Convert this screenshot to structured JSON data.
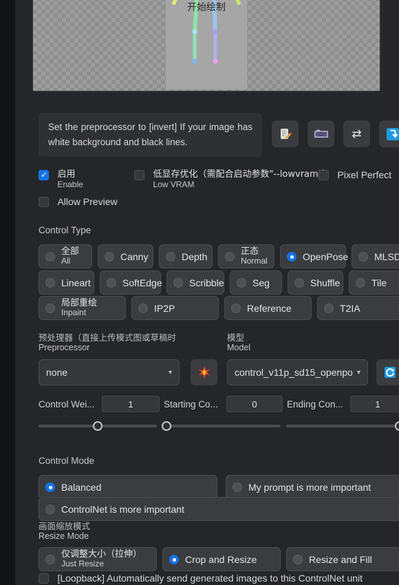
{
  "preview": {
    "caption": "开始绘制",
    "alt_name": "openpose-skeleton-preview"
  },
  "tip": {
    "text": "Set the preprocessor to [invert] If your image has white background and black lines.",
    "buttons": [
      {
        "name": "edit-image-icon",
        "glyph": ""
      },
      {
        "name": "camera-icon",
        "glyph": ""
      },
      {
        "name": "swap-icon",
        "glyph": "⇄"
      },
      {
        "name": "send-to-icon",
        "glyph": ""
      }
    ]
  },
  "options": {
    "enable": {
      "zh": "启用",
      "en": "Enable",
      "checked": true
    },
    "low_vram": {
      "zh": "低显存优化（需配合启动参数\"--lowvram\"）",
      "en": "Low VRAM",
      "checked": false
    },
    "pixel_perfect": {
      "label": "Pixel Perfect",
      "checked": false
    },
    "allow_preview": {
      "label": "Allow Preview",
      "checked": false
    }
  },
  "control_type": {
    "label": "Control Type",
    "selected": "OpenPose",
    "items": [
      {
        "zh": "全部",
        "en": "All",
        "selected": false
      },
      {
        "zh": "",
        "en": "Canny",
        "selected": false
      },
      {
        "zh": "",
        "en": "Depth",
        "selected": false
      },
      {
        "zh": "正态",
        "en": "Normal",
        "selected": false
      },
      {
        "zh": "",
        "en": "OpenPose",
        "selected": true
      },
      {
        "zh": "",
        "en": "MLSD",
        "selected": false
      },
      {
        "zh": "",
        "en": "Lineart",
        "selected": false
      },
      {
        "zh": "",
        "en": "SoftEdge",
        "selected": false
      },
      {
        "zh": "",
        "en": "Scribble",
        "selected": false
      },
      {
        "zh": "",
        "en": "Seg",
        "selected": false
      },
      {
        "zh": "",
        "en": "Shuffle",
        "selected": false
      },
      {
        "zh": "",
        "en": "Tile",
        "selected": false
      },
      {
        "zh": "局部重绘",
        "en": "Inpaint",
        "selected": false
      },
      {
        "zh": "",
        "en": "IP2P",
        "selected": false
      },
      {
        "zh": "",
        "en": "Reference",
        "selected": false
      },
      {
        "zh": "",
        "en": "T2IA",
        "selected": false
      }
    ]
  },
  "preprocessor": {
    "label_zh": "预处理器（直接上传模式图或草稿时",
    "label_en": "Preprocessor",
    "value": "none",
    "caret": "▾",
    "run_button_name": "run-preprocessor-button"
  },
  "model": {
    "label_zh": "模型",
    "label_en": "Model",
    "value": "control_v11p_sd15_openpo",
    "caret": "▾",
    "refresh_button_name": "refresh-models-button"
  },
  "sliders": [
    {
      "label": "Control Wei...",
      "value": "1",
      "pct": 50,
      "name": "control-weight"
    },
    {
      "label": "Starting Co...",
      "value": "0",
      "pct": 0,
      "name": "starting-control-step"
    },
    {
      "label": "Ending Con...",
      "value": "1",
      "pct": 100,
      "name": "ending-control-step"
    }
  ],
  "control_mode": {
    "label": "Control Mode",
    "items": [
      {
        "label": "Balanced",
        "selected": true
      },
      {
        "label": "My prompt is more important",
        "selected": false
      },
      {
        "label": "ControlNet is more important",
        "selected": false
      }
    ]
  },
  "resize_mode": {
    "label_zh": "画面缩放模式",
    "label_en": "Resize Mode",
    "items": [
      {
        "zh": "仅调整大小（拉伸）",
        "en": "Just Resize",
        "selected": false
      },
      {
        "zh": "",
        "en": "Crop and Resize",
        "selected": true
      },
      {
        "zh": "",
        "en": "Resize and Fill",
        "selected": false
      }
    ]
  },
  "loopback": {
    "label": "[Loopback] Automatically send generated images to this ControlNet unit",
    "checked": false
  },
  "colors": {
    "accent": "#1473e6",
    "panel_bg": "#25262a",
    "pill_bg": "#3a3c40"
  }
}
